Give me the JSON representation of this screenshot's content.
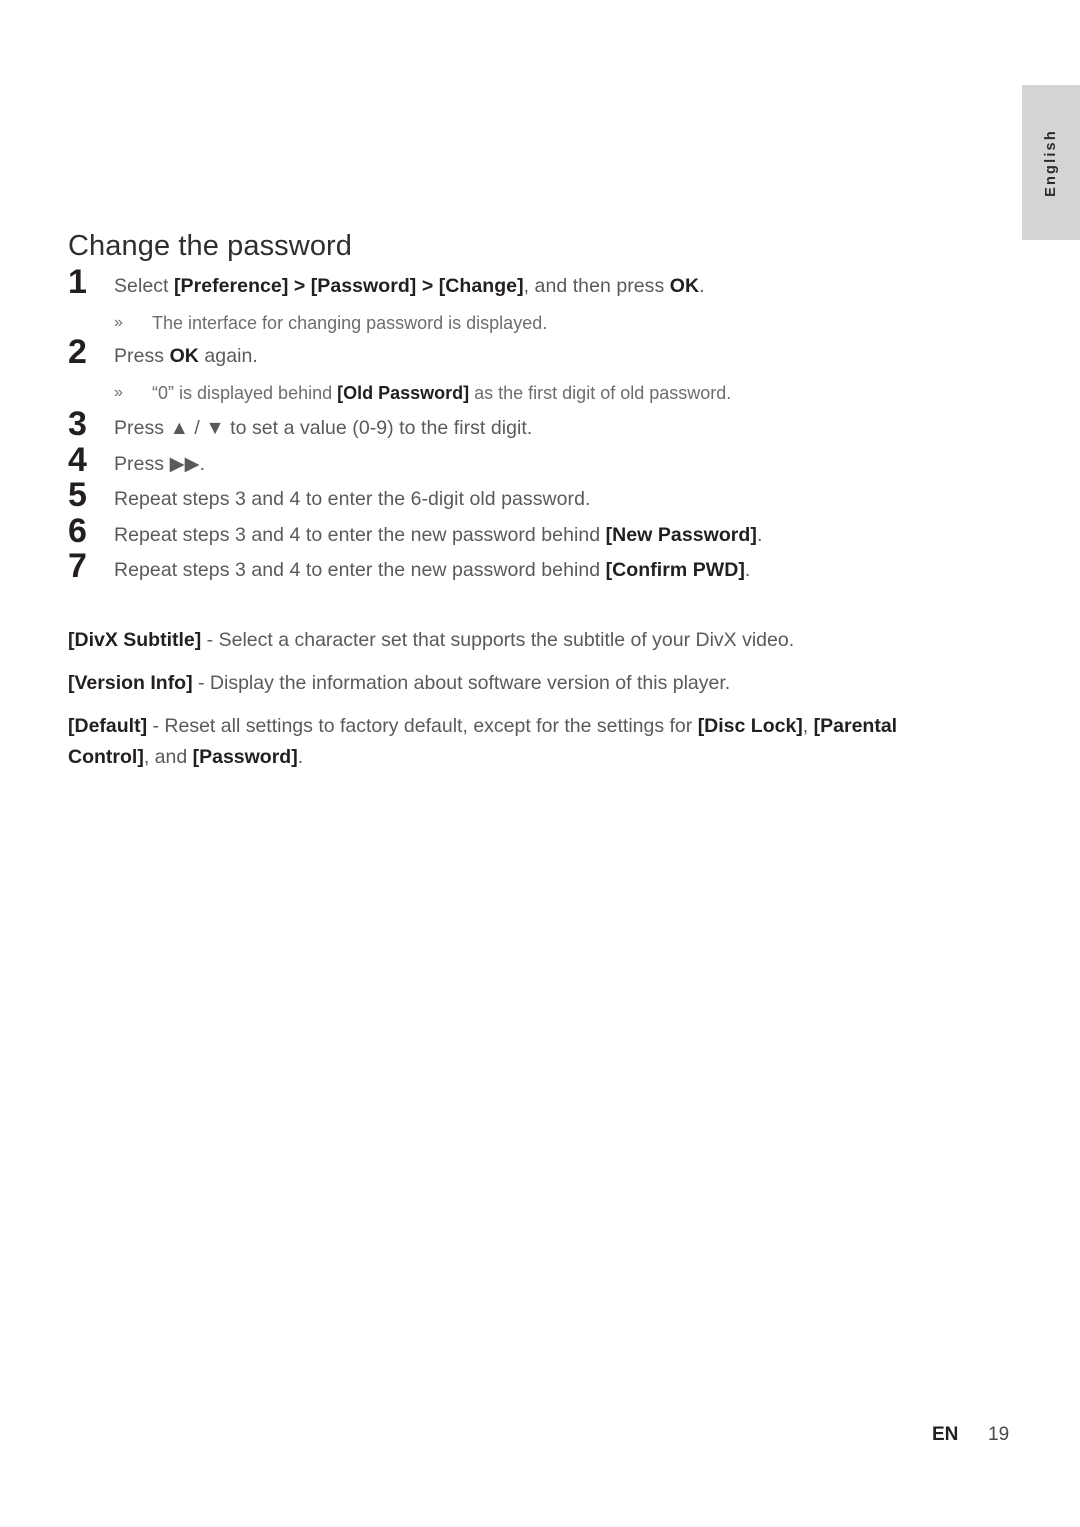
{
  "side_tab": {
    "label": "English"
  },
  "page": {
    "heading": "Change the password"
  },
  "steps": [
    {
      "number": "1",
      "text_parts": [
        {
          "text": "Select ",
          "bold": false
        },
        {
          "text": "[Preference] > [Password] > [Change]",
          "bold": true
        },
        {
          "text": ", and then press ",
          "bold": false
        },
        {
          "text": "OK",
          "bold": true
        },
        {
          "text": ".",
          "bold": false
        }
      ],
      "plain": "Select [Preference] > [Password] > [Change], and then press OK."
    },
    {
      "number": "2",
      "text_parts": [
        {
          "text": "Press ",
          "bold": false
        },
        {
          "text": "OK",
          "bold": true
        },
        {
          "text": " again.",
          "bold": false
        }
      ],
      "plain": "Press OK again."
    },
    {
      "number": "3",
      "text_parts": [
        {
          "text": "Press ▲ / ▼ to set a value (0-9) to the first digit.",
          "bold": false
        }
      ],
      "plain": "Press ▲ / ▼ to set a value (0-9) to the first digit."
    },
    {
      "number": "4",
      "text_parts": [
        {
          "text": "Press ▶▶.",
          "bold": false
        }
      ],
      "plain": "Press ▶▶."
    },
    {
      "number": "5",
      "text_parts": [
        {
          "text": "Repeat steps 3 and 4 to enter the 6-digit old password.",
          "bold": false
        }
      ],
      "plain": "Repeat steps 3 and 4 to enter the 6-digit old password."
    },
    {
      "number": "6",
      "text_parts": [
        {
          "text": "Repeat steps 3 and 4 to enter the new password behind ",
          "bold": false
        },
        {
          "text": "[New Password]",
          "bold": true
        },
        {
          "text": ".",
          "bold": false
        }
      ],
      "plain": "Repeat steps 3 and 4 to enter the new password behind [New Password]."
    },
    {
      "number": "7",
      "text_parts": [
        {
          "text": "Repeat steps 3 and 4 to enter the new password behind ",
          "bold": false
        },
        {
          "text": "[Confirm PWD]",
          "bold": true
        },
        {
          "text": ".",
          "bold": false
        }
      ],
      "plain": "Repeat steps 3 and 4 to enter the new password behind [Confirm PWD]."
    }
  ],
  "substeps": {
    "bullet": "»",
    "after_step_1": {
      "text_parts": [
        {
          "text": "The interface for changing password is displayed.",
          "bold": false
        }
      ],
      "plain": "The interface for changing password is displayed."
    },
    "after_step_2": {
      "text_parts": [
        {
          "text": "“0” is displayed behind ",
          "bold": false
        },
        {
          "text": "[Old Password]",
          "bold": true
        },
        {
          "text": " as the first digit of old password.",
          "bold": false
        }
      ],
      "plain": "“0” is displayed behind [Old Password] as the first digit of old password."
    }
  },
  "paragraphs": [
    {
      "id": "divx-subtitle",
      "text_parts": [
        {
          "text": "[DivX Subtitle]",
          "bold": true
        },
        {
          "text": " - Select a character set that supports the subtitle of your DivX video.",
          "bold": false
        }
      ],
      "plain": "[DivX Subtitle] - Select a character set that supports the subtitle of your DivX video."
    },
    {
      "id": "version-info",
      "text_parts": [
        {
          "text": "[Version Info]",
          "bold": true
        },
        {
          "text": " - Display the information about software version of this player.",
          "bold": false
        }
      ],
      "plain": "[Version Info] - Display the information about software version of this player."
    },
    {
      "id": "default",
      "text_parts": [
        {
          "text": "[Default]",
          "bold": true
        },
        {
          "text": " - Reset all settings to factory default, except for the settings for ",
          "bold": false
        },
        {
          "text": "[Disc Lock]",
          "bold": true
        },
        {
          "text": ", ",
          "bold": false
        },
        {
          "text": "[Parental Control]",
          "bold": true
        },
        {
          "text": ", and ",
          "bold": false
        },
        {
          "text": "[Password]",
          "bold": true
        },
        {
          "text": ".",
          "bold": false
        }
      ],
      "plain": "[Default] - Reset all settings to factory default, except for the settings for [Disc Lock], [Parental Control], and [Password]."
    }
  ],
  "footer": {
    "language_code": "EN",
    "page_number": "19"
  },
  "colors": {
    "body_text": "#5a5a5a",
    "emphasis_text": "#231f20",
    "muted_text": "#6d6d6d",
    "tab_background": "#d3d4d5",
    "page_background": "#ffffff"
  }
}
